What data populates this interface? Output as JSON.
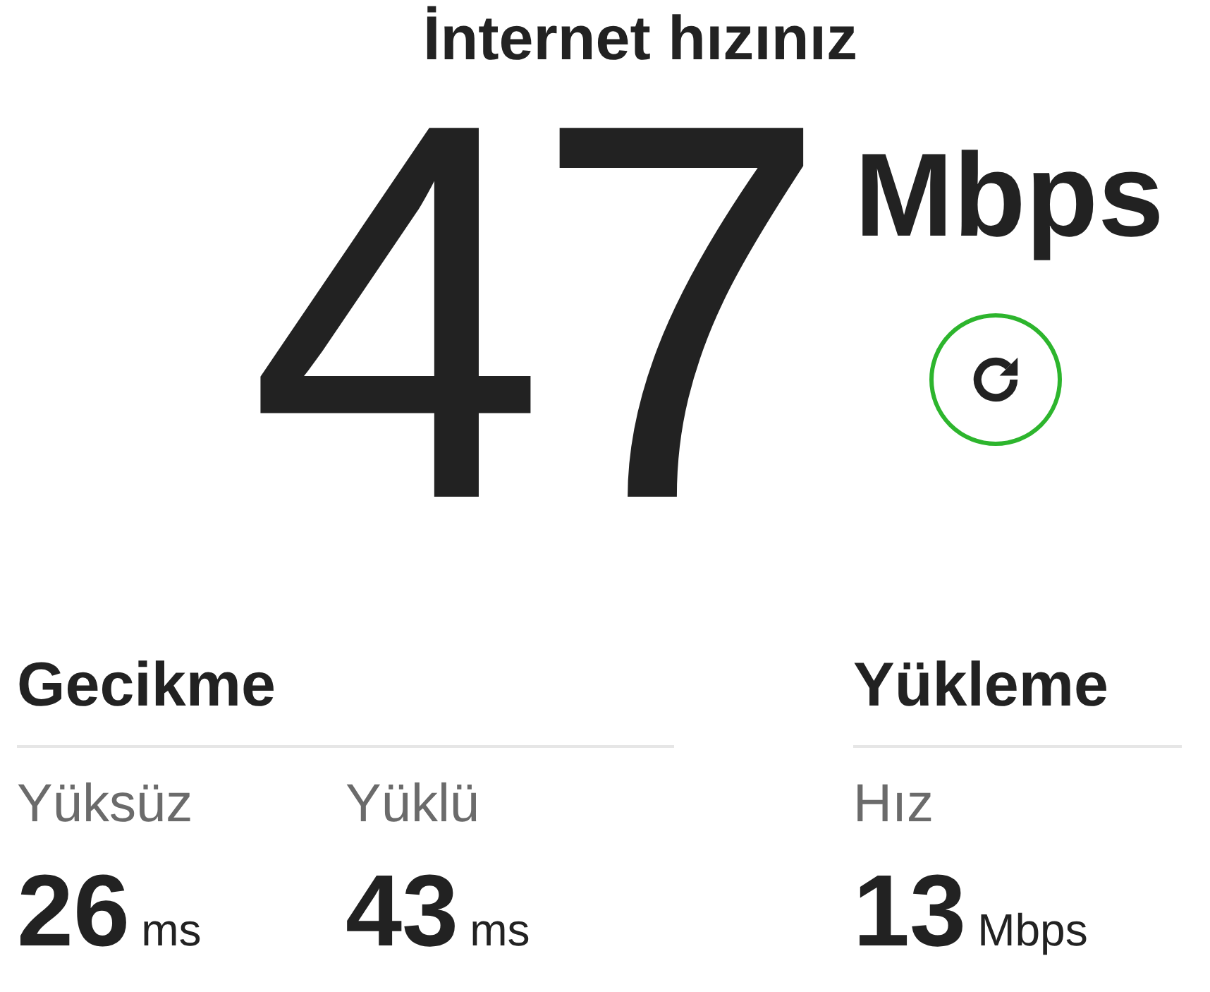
{
  "title": "İnternet hızınız",
  "speed": {
    "value": "47",
    "unit": "Mbps"
  },
  "latency": {
    "heading": "Gecikme",
    "items": [
      {
        "label": "Yüksüz",
        "value": "26",
        "unit": "ms"
      },
      {
        "label": "Yüklü",
        "value": "43",
        "unit": "ms"
      }
    ]
  },
  "upload": {
    "heading": "Yükleme",
    "items": [
      {
        "label": "Hız",
        "value": "13",
        "unit": "Mbps"
      }
    ]
  }
}
